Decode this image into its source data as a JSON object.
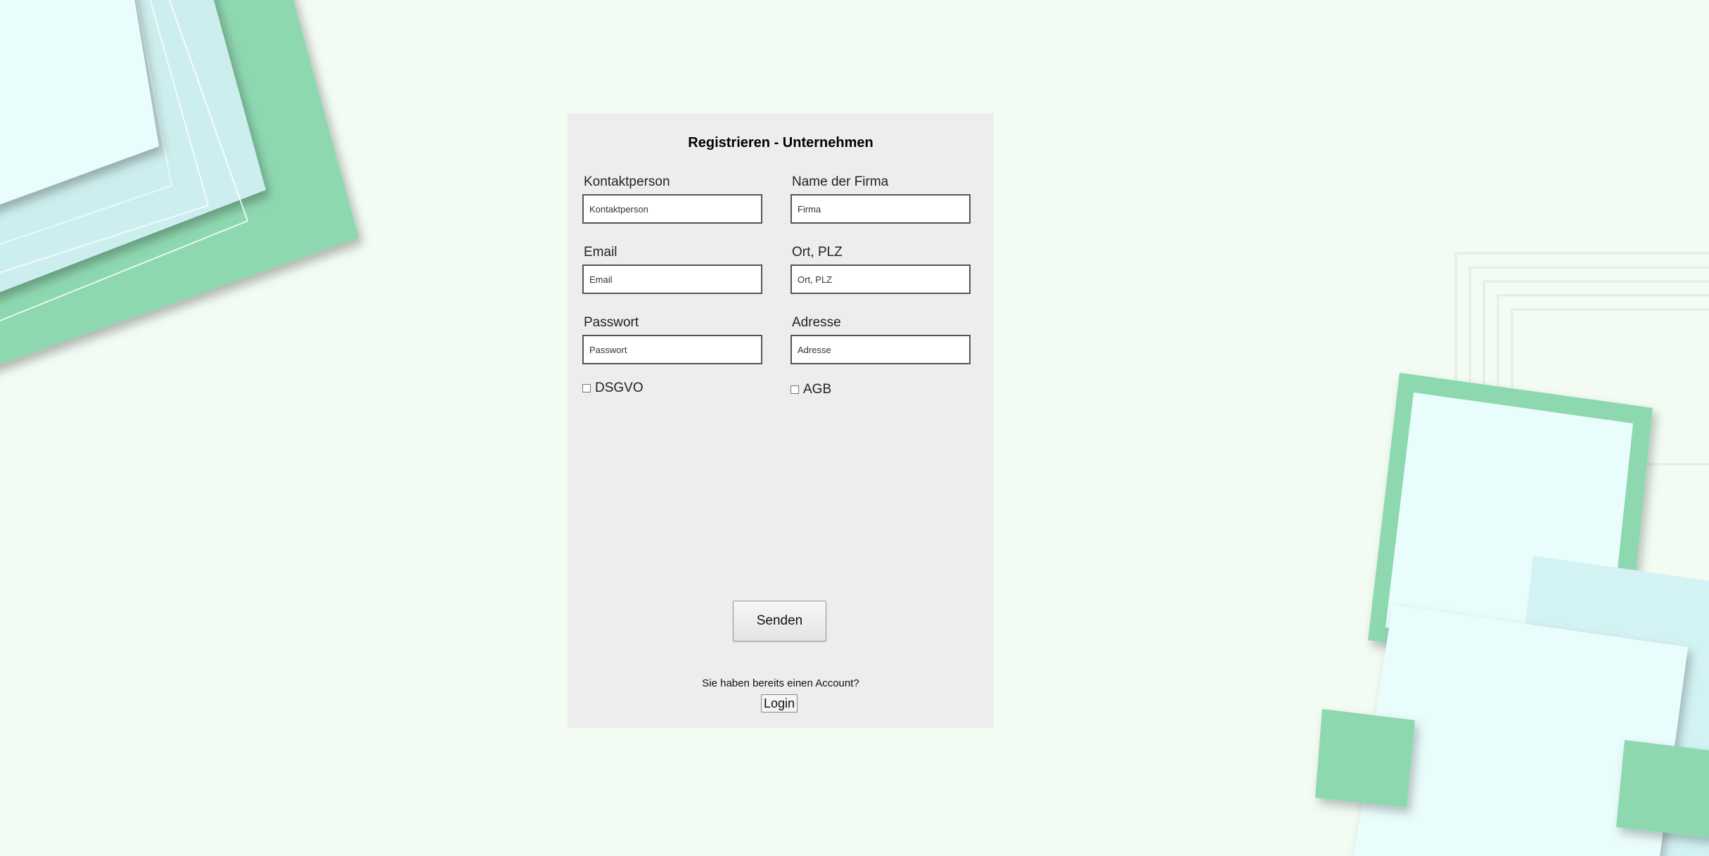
{
  "form": {
    "title": "Registrieren - Unternehmen",
    "fields": [
      {
        "label": "Kontaktperson",
        "placeholder": "Kontaktperson",
        "value": ""
      },
      {
        "label": "Name der Firma",
        "placeholder": "Firma",
        "value": ""
      },
      {
        "label": "Email",
        "placeholder": "Email",
        "value": ""
      },
      {
        "label": "Ort, PLZ",
        "placeholder": "Ort, PLZ",
        "value": ""
      },
      {
        "label": "Passwort",
        "placeholder": "Passwort",
        "value": ""
      },
      {
        "label": "Adresse",
        "placeholder": "Adresse",
        "value": ""
      }
    ],
    "checkboxes": [
      {
        "label": "DSGVO",
        "checked": false
      },
      {
        "label": "AGB",
        "checked": false
      }
    ],
    "submit_label": "Senden",
    "account_prompt": "Sie haben bereits einen Account?",
    "login_label": "Login"
  },
  "colors": {
    "page_background": "#f2fcf3",
    "card_background": "#ededed",
    "accent_green": "#8ed8b0",
    "accent_light_cyan": "#eafdfd"
  }
}
